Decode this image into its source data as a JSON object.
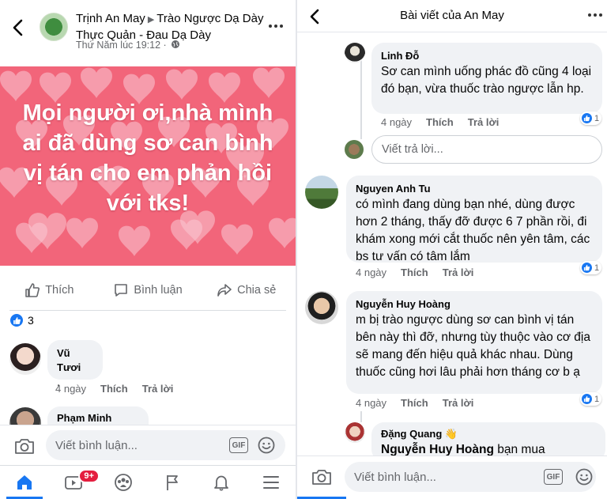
{
  "left": {
    "author": "Trịnh An May",
    "group": "Trào Ngược Dạ Dày Thực Quản - Đau Dạ Dày",
    "timestamp": "Thứ Năm lúc 19:12 ·",
    "post_text": "Mọi người ơi,nhà mình ai đã dùng sơ can bình vị tán cho em phản hồi với tks!",
    "actions": {
      "like": "Thích",
      "comment": "Bình luận",
      "share": "Chia sẻ"
    },
    "reaction_count": "3",
    "comments": [
      {
        "name": "Vũ Tươi",
        "text": ".",
        "time": "4 ngày",
        "like": "Thích",
        "reply": "Trả lời"
      },
      {
        "name": "Phạm Minh Quân"
      }
    ],
    "composer_placeholder": "Viết bình luận...",
    "gif_label": "GIF",
    "tabs": [
      "home-icon",
      "watch-icon",
      "groups-icon",
      "pages-icon",
      "notifications-icon",
      "menu-icon"
    ],
    "watch_badge": "9+"
  },
  "right": {
    "title": "Bài viết của An May",
    "comments": [
      {
        "name": "Linh Đỗ",
        "text": "Sơ can mình uống phác đồ cũng 4 loại đó bạn, vừa thuốc trào ngược lẫn hp.",
        "time": "4 ngày",
        "like": "Thích",
        "reply": "Trả lời",
        "likes": "1"
      },
      {
        "name": "Nguyen Anh Tu",
        "text": "có mình đang dùng bạn nhé, dùng được hơn 2 tháng, thấy đỡ được 6 7 phần rồi, đi khám xong mới cắt thuốc nên yên tâm, các bs tư vấn có tâm lắm",
        "time": "4 ngày",
        "like": "Thích",
        "reply": "Trả lời",
        "likes": "1"
      },
      {
        "name": "Nguyễn Huy Hoàng",
        "text": "m bị trào ngược dùng sơ can bình vị tán bên này thì đỡ, nhưng tùy thuộc vào cơ địa sẽ mang đến hiệu quả khác nhau. Dùng thuốc cũng hơi lâu phải hơn tháng cơ b ạ",
        "time": "4 ngày",
        "like": "Thích",
        "reply": "Trả lời",
        "likes": "1"
      },
      {
        "name": "Đặng Quang",
        "mention": "Nguyễn Huy Hoàng",
        "text": "bạn mua"
      }
    ],
    "reply_placeholder": "Viết trả lời...",
    "composer_placeholder": "Viết bình luận...",
    "gif_label": "GIF"
  },
  "colors": {
    "accent": "#1877f2",
    "post_bg": "#f2657a",
    "badge_red": "#e41e3f"
  }
}
